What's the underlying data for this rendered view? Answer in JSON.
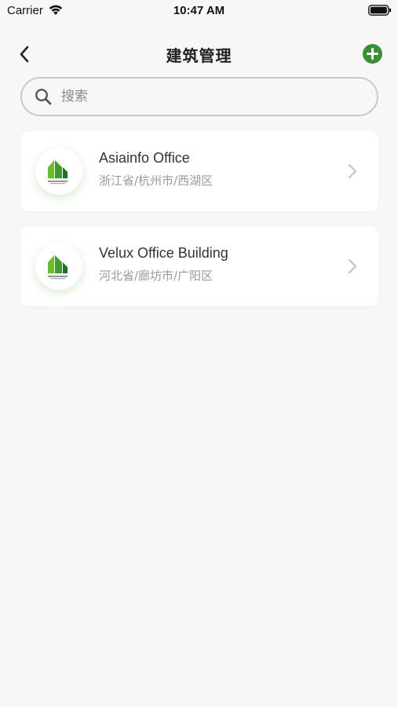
{
  "status_bar": {
    "carrier": "Carrier",
    "time": "10:47 AM",
    "icons": [
      "wifi-icon",
      "battery-icon"
    ]
  },
  "nav": {
    "title": "建筑管理",
    "back_icon": "chevron-left-icon",
    "add_icon": "plus-circle-icon"
  },
  "search": {
    "placeholder": "搜索",
    "value": "",
    "icon": "search-icon"
  },
  "buildings": [
    {
      "name": "Asiainfo Office",
      "location": "浙江省/杭州市/西湖区",
      "logo": "activehouse-logo"
    },
    {
      "name": "Velux Office Building",
      "location": "河北省/廊坊市/广阳区",
      "logo": "activehouse-logo"
    }
  ],
  "colors": {
    "background": "#f7f7f7",
    "accent": "#3a8f35",
    "card": "#ffffff",
    "secondary_text": "#9a9a9a"
  }
}
